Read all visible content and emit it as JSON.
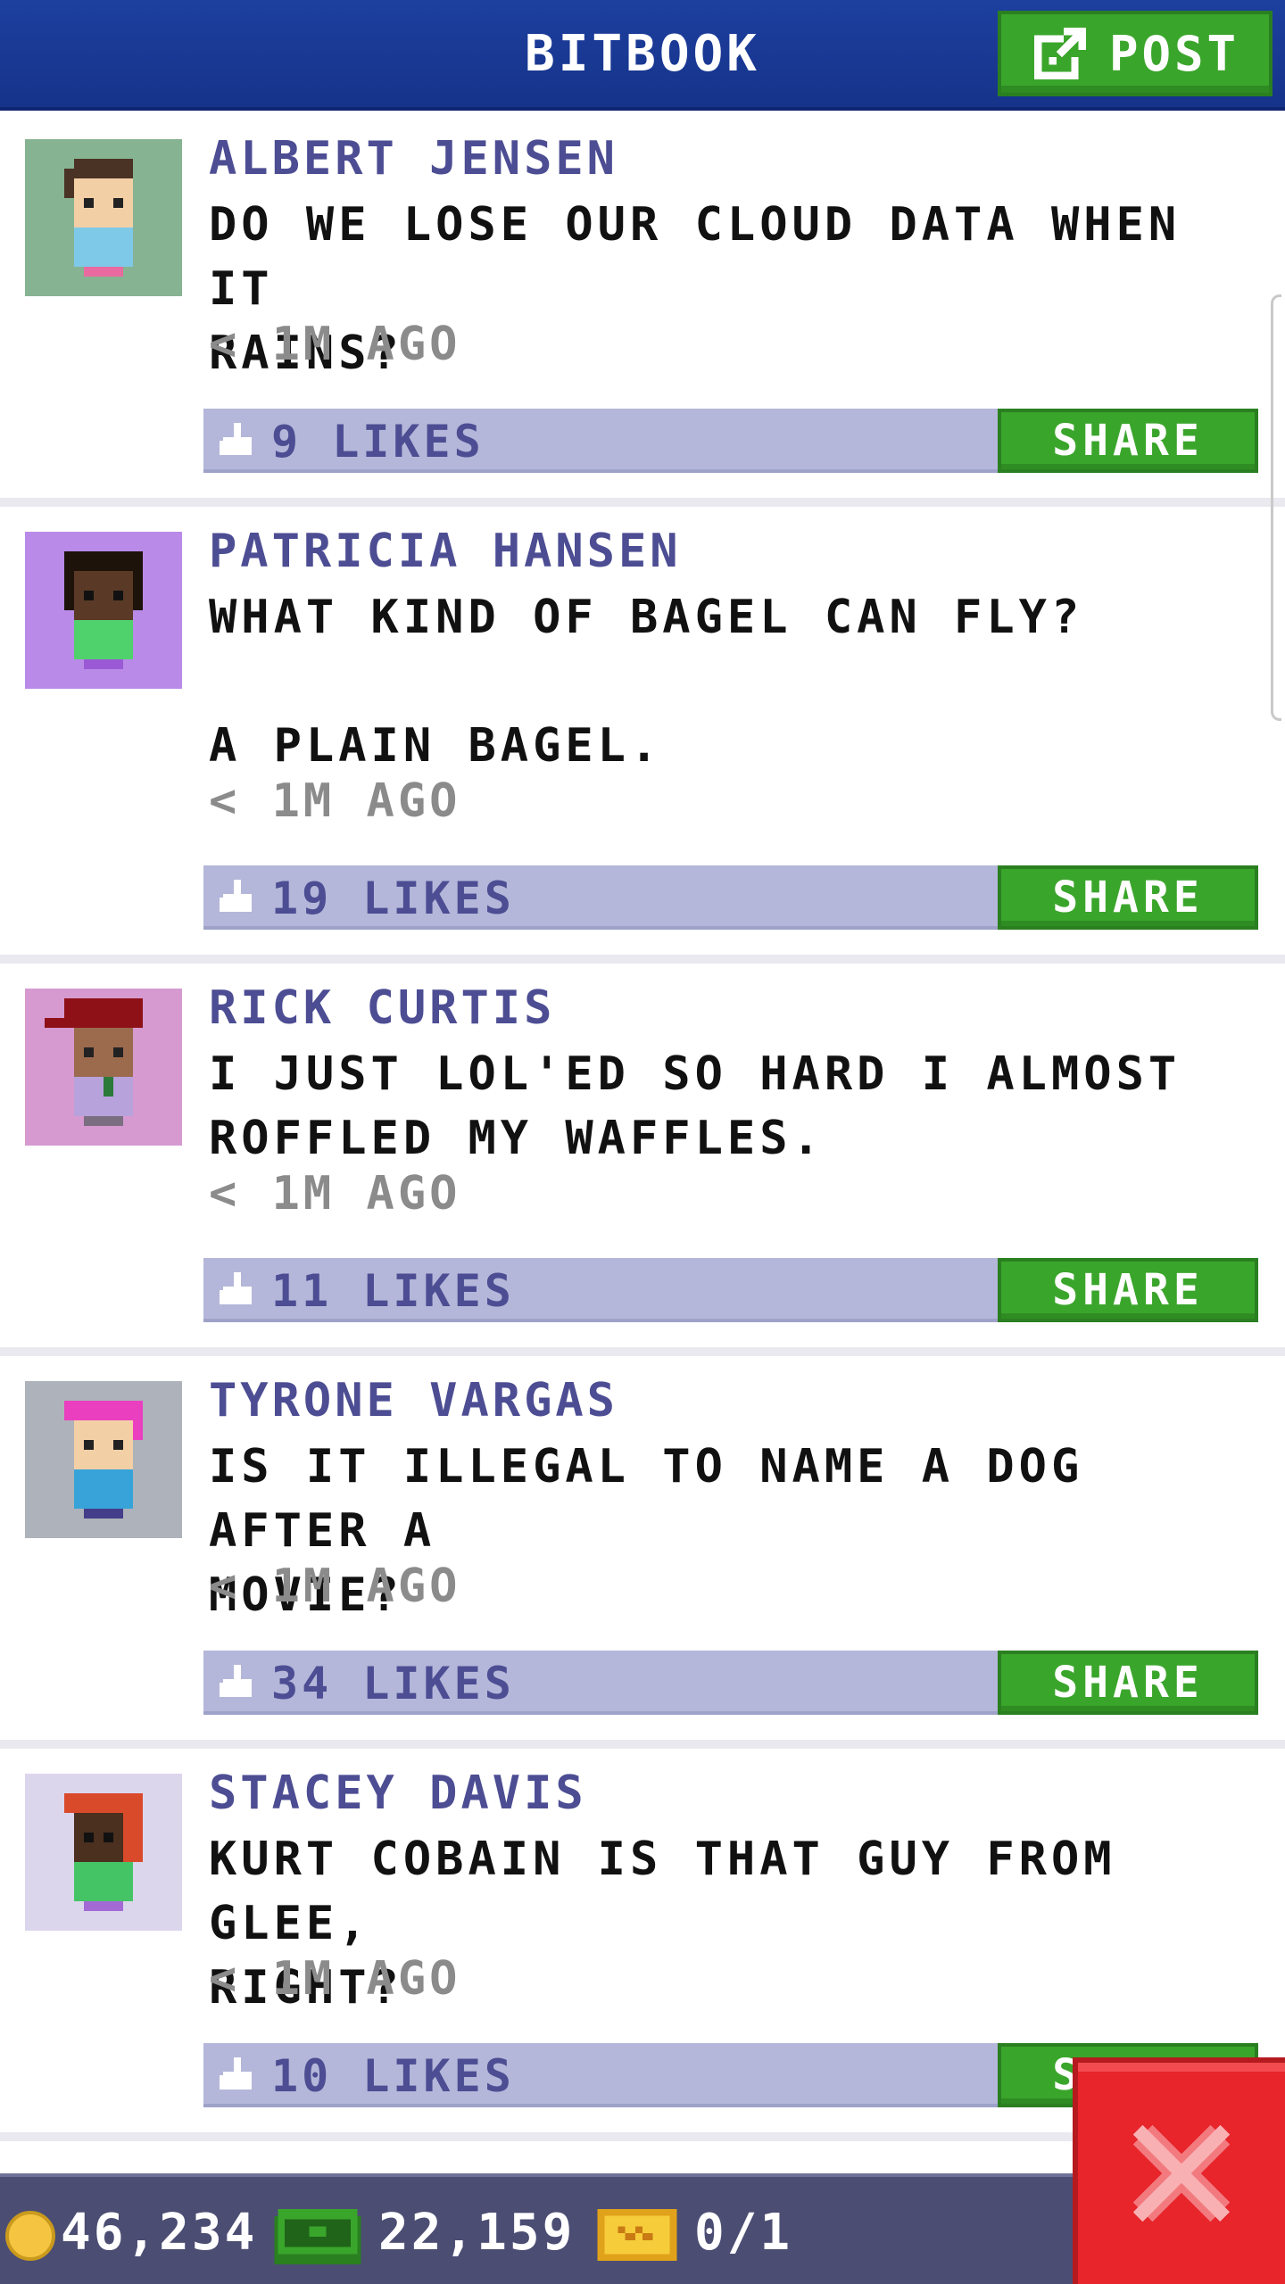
{
  "header": {
    "title": "BITBOOK",
    "post_label": "POST"
  },
  "posts": [
    {
      "author": "ALBERT JENSEN",
      "text": "DO WE LOSE OUR CLOUD DATA WHEN IT\nRAINS?",
      "time": "< 1M AGO",
      "likes": "9 LIKES",
      "share_label": "SHARE",
      "avatar_bg": "#86b391",
      "hair_color": "#4a3325",
      "skin_color": "#f3cfa6",
      "shirt_color": "#7ec9e8",
      "pants_color": "#e86aa0"
    },
    {
      "author": "PATRICIA HANSEN",
      "text": "WHAT KIND OF BAGEL CAN FLY?\n\nA PLAIN BAGEL.",
      "time": "< 1M AGO",
      "likes": "19 LIKES",
      "share_label": "SHARE",
      "avatar_bg": "#b98ae8",
      "hair_color": "#1e130b",
      "skin_color": "#5a3a26",
      "shirt_color": "#4fd26c",
      "pants_color": "#9b59d6"
    },
    {
      "author": "RICK CURTIS",
      "text": "I JUST LOL'ED SO HARD I ALMOST\nROFFLED MY WAFFLES.",
      "time": "< 1M AGO",
      "likes": "11 LIKES",
      "share_label": "SHARE",
      "avatar_bg": "#d69ad0",
      "hair_color": "#8e1118",
      "skin_color": "#9c6a4d",
      "shirt_color": "#b7a2dc",
      "pants_color": "#7a6e80"
    },
    {
      "author": "TYRONE VARGAS",
      "text": "IS IT ILLEGAL TO NAME A DOG AFTER A\nMOVIE?",
      "time": "< 1M AGO",
      "likes": "34 LIKES",
      "share_label": "SHARE",
      "avatar_bg": "#aeb2ba",
      "hair_color": "#ea3fbf",
      "skin_color": "#f3cfa6",
      "shirt_color": "#37a3d9",
      "pants_color": "#443d8a"
    },
    {
      "author": "STACEY DAVIS",
      "text": "KURT COBAIN IS THAT GUY FROM GLEE,\nRIGHT?",
      "time": "< 1M AGO",
      "likes": "10 LIKES",
      "share_label": "SHARE",
      "avatar_bg": "#dcd6ec",
      "hair_color": "#d94a2b",
      "skin_color": "#4b2f1f",
      "shirt_color": "#45c466",
      "pants_color": "#a36ad6"
    }
  ],
  "status": {
    "coins": "46,234",
    "bux": "22,159",
    "tickets": "0/1"
  },
  "colors": {
    "header_blue": "#1d3f9e",
    "share_green": "#3aa52b",
    "like_bar": "#b4b7d9",
    "author_text": "#4c4d93",
    "close_red": "#e7252b"
  }
}
